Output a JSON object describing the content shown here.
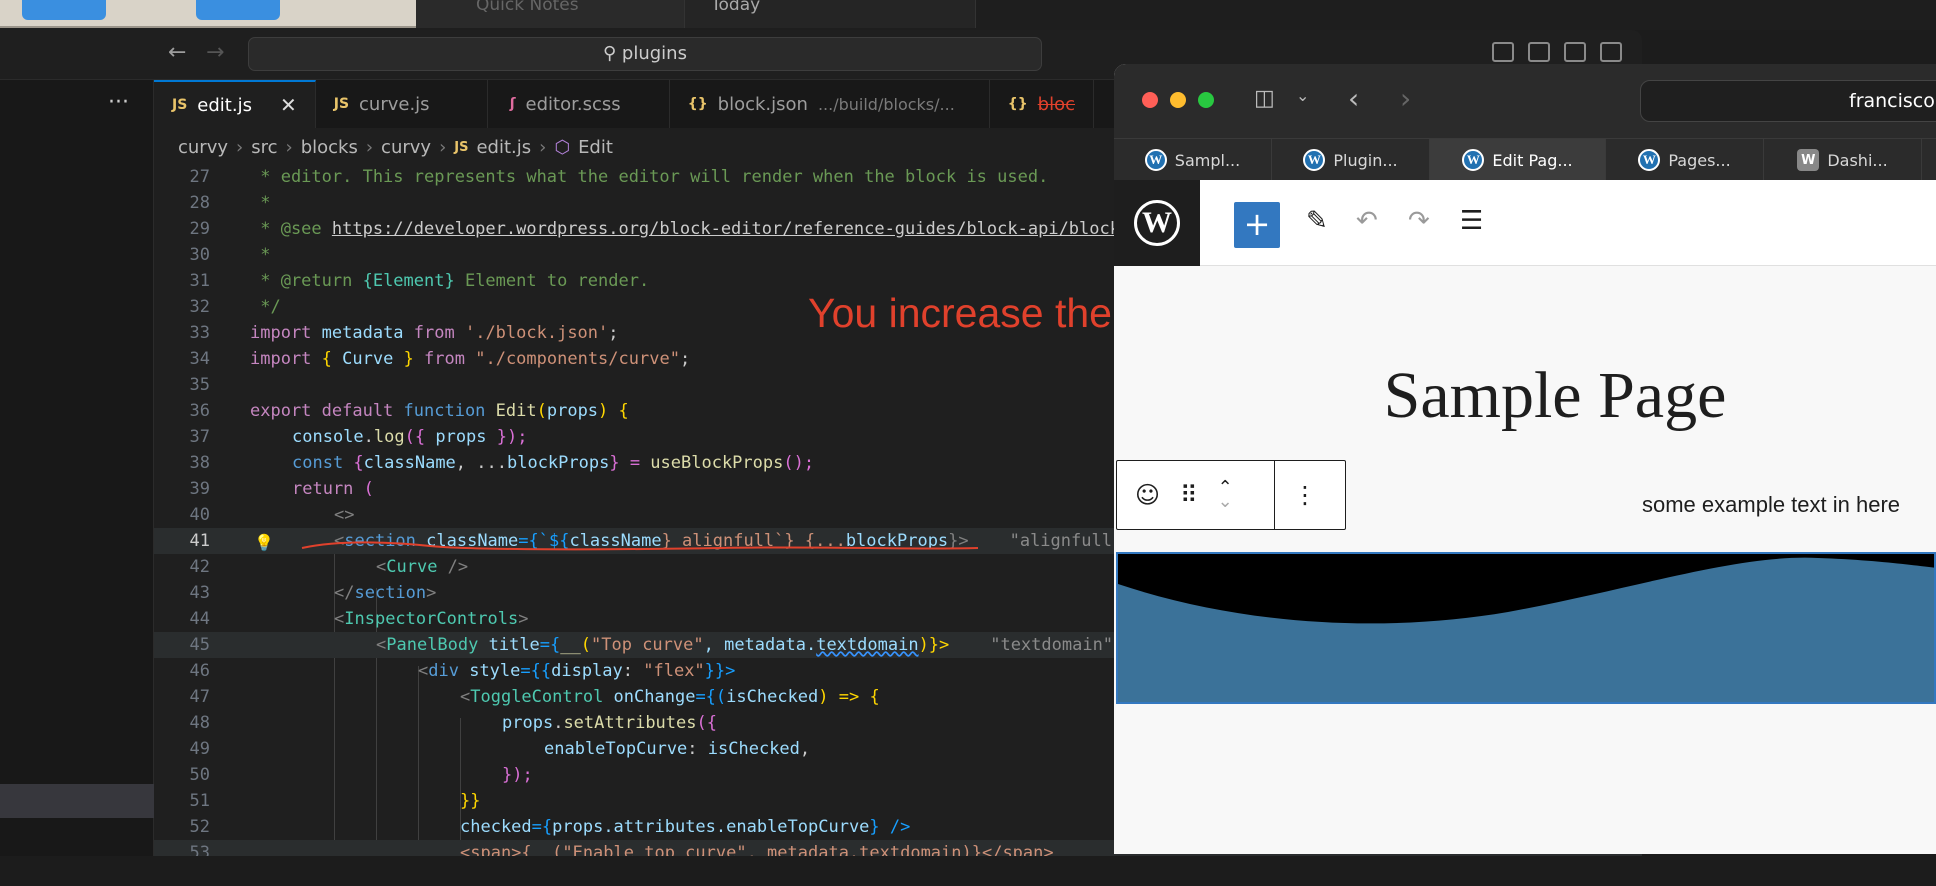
{
  "top": {
    "quick_notes": "Quick Notes",
    "today": "Today"
  },
  "vscode": {
    "search": "plugins",
    "tabs": [
      {
        "icon": "JS",
        "label": "edit.js",
        "desc": ""
      },
      {
        "icon": "JS",
        "label": "curve.js",
        "desc": ""
      },
      {
        "icon": "ʃ",
        "label": "editor.scss",
        "desc": ""
      },
      {
        "icon": "{}",
        "label": "block.json",
        "desc": ".../build/blocks/..."
      },
      {
        "icon": "{}",
        "label": "bloc",
        "desc": ""
      }
    ],
    "breadcrumb": [
      "curvy",
      "src",
      "blocks",
      "curvy",
      "edit.js",
      "Edit"
    ],
    "breadcrumb_js_icon": "JS",
    "lines": {
      "n27": "27",
      "n28": "28",
      "n29": "29",
      "n30": "30",
      "n31": "31",
      "n32": "32",
      "n33": "33",
      "n34": "34",
      "n35": "35",
      "n36": "36",
      "n37": "37",
      "n38": "38",
      "n39": "39",
      "n40": "40",
      "n41": "41",
      "n42": "42",
      "n43": "43",
      "n44": "44",
      "n45": "45",
      "n46": "46",
      "n47": "47",
      "n48": "48",
      "n49": "49",
      "n50": "50",
      "n51": "51",
      "n52": "52",
      "n53": "53"
    },
    "code": {
      "l27": " * editor. This represents what the editor will render when the block is used.",
      "l28": " *",
      "l29_a": " * @see ",
      "l29_b": "https://developer.wordpress.org/block-editor/reference-guides/block-api/block-edit-save/#edit",
      "l30": " *",
      "l31_a": " * @return ",
      "l31_b": "{Element}",
      "l31_c": " Element to render.",
      "l32": " */",
      "l33_a": "import",
      "l33_b": " metadata ",
      "l33_c": "from",
      "l33_d": " './block.json'",
      "l33_e": ";",
      "l34_a": "import",
      "l34_b": " { ",
      "l34_c": "Curve",
      "l34_d": " } ",
      "l34_e": "from",
      "l34_f": " \"./components/curve\"",
      "l34_g": ";",
      "l36_a": "export default ",
      "l36_b": "function",
      "l36_c": " Edit",
      "l36_d": "(",
      "l36_e": "props",
      "l36_f": ") {",
      "l37_a": "console",
      "l37_b": ".",
      "l37_c": "log",
      "l37_d": "({ ",
      "l37_e": "props",
      "l37_f": " });",
      "l38_a": "const",
      "l38_b": " {",
      "l38_c": "className",
      "l38_d": ", ...",
      "l38_e": "blockProps",
      "l38_f": "} = ",
      "l38_g": "useBlockProps",
      "l38_h": "();",
      "l39_a": "return",
      "l39_b": " (",
      "l40": "<>",
      "l41_a": "<",
      "l41_b": "section",
      "l41_c": " className",
      "l41_d": "={`${",
      "l41_e": "className",
      "l41_f": "} alignfull`} {...",
      "l41_g": "blockProps",
      "l41_h": "}>",
      "l41_ghost": "    \"alignfull\"",
      "l42_a": "<",
      "l42_b": "Curve",
      "l42_c": " />",
      "l43_a": "</",
      "l43_b": "section",
      "l43_c": ">",
      "l44_a": "<",
      "l44_b": "InspectorControls",
      "l44_c": ">",
      "l45_a": "<",
      "l45_b": "PanelBody",
      "l45_c": " title",
      "l45_d": "={",
      "l45_e": "__",
      "l45_f": "(",
      "l45_g": "\"Top curve\"",
      "l45_h": ", metadata.",
      "l45_i": "textdomain",
      "l45_j": ")}>",
      "l45_ghost": "    \"textdomain\"",
      "l46_a": "<",
      "l46_b": "div",
      "l46_c": " style",
      "l46_d": "={{",
      "l46_e": "display",
      "l46_f": ": ",
      "l46_g": "\"flex\"",
      "l46_h": "}}>",
      "l47_a": "<",
      "l47_b": "ToggleControl",
      "l47_c": " onChange",
      "l47_d": "={(",
      "l47_e": "isChecked",
      "l47_f": ") => {",
      "l48_a": "props",
      "l48_b": ".",
      "l48_c": "setAttributes",
      "l48_d": "({",
      "l49_a": "enableTopCurve",
      "l49_b": ": ",
      "l49_c": "isChecked",
      "l49_d": ",",
      "l50": "});",
      "l51": "}}",
      "l52_a": "checked",
      "l52_b": "={",
      "l52_c": "props.attributes.enableTopCurve",
      "l52_d": "} />",
      "l53": "<span>{__(\"Enable top curve\", metadata.textdomain)}</span>"
    }
  },
  "annotation": "You increase the width of the curve",
  "browser": {
    "address": "francisco",
    "tabs": [
      "Sampl...",
      "Plugin...",
      "Edit Pag...",
      "Pages...",
      "Dashi..."
    ],
    "active_tab_index": 2
  },
  "wp": {
    "page_title": "Sample Page",
    "example_text": "some example text in here",
    "accent": "#3378c0",
    "curve_color": "#3b7299"
  }
}
